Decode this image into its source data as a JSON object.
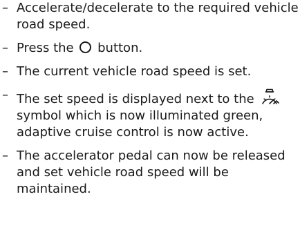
{
  "steps": [
    {
      "dash": "–",
      "text": "Accelerate/decelerate to the required vehicle road speed."
    },
    {
      "dash": "–",
      "before": "Press the",
      "icon": "circle-button-icon",
      "after": "button."
    },
    {
      "dash": "–",
      "text": "The current vehicle road speed is set."
    },
    {
      "dash": "–",
      "before": "The set speed is displayed next to the",
      "icon": "adaptive-cruise-control-icon",
      "after": "symbol which is now illuminated green, adaptive cruise control is now active."
    },
    {
      "dash": "–",
      "text": "The accelerator pedal can now be released and set vehicle road speed will be maintained."
    }
  ]
}
